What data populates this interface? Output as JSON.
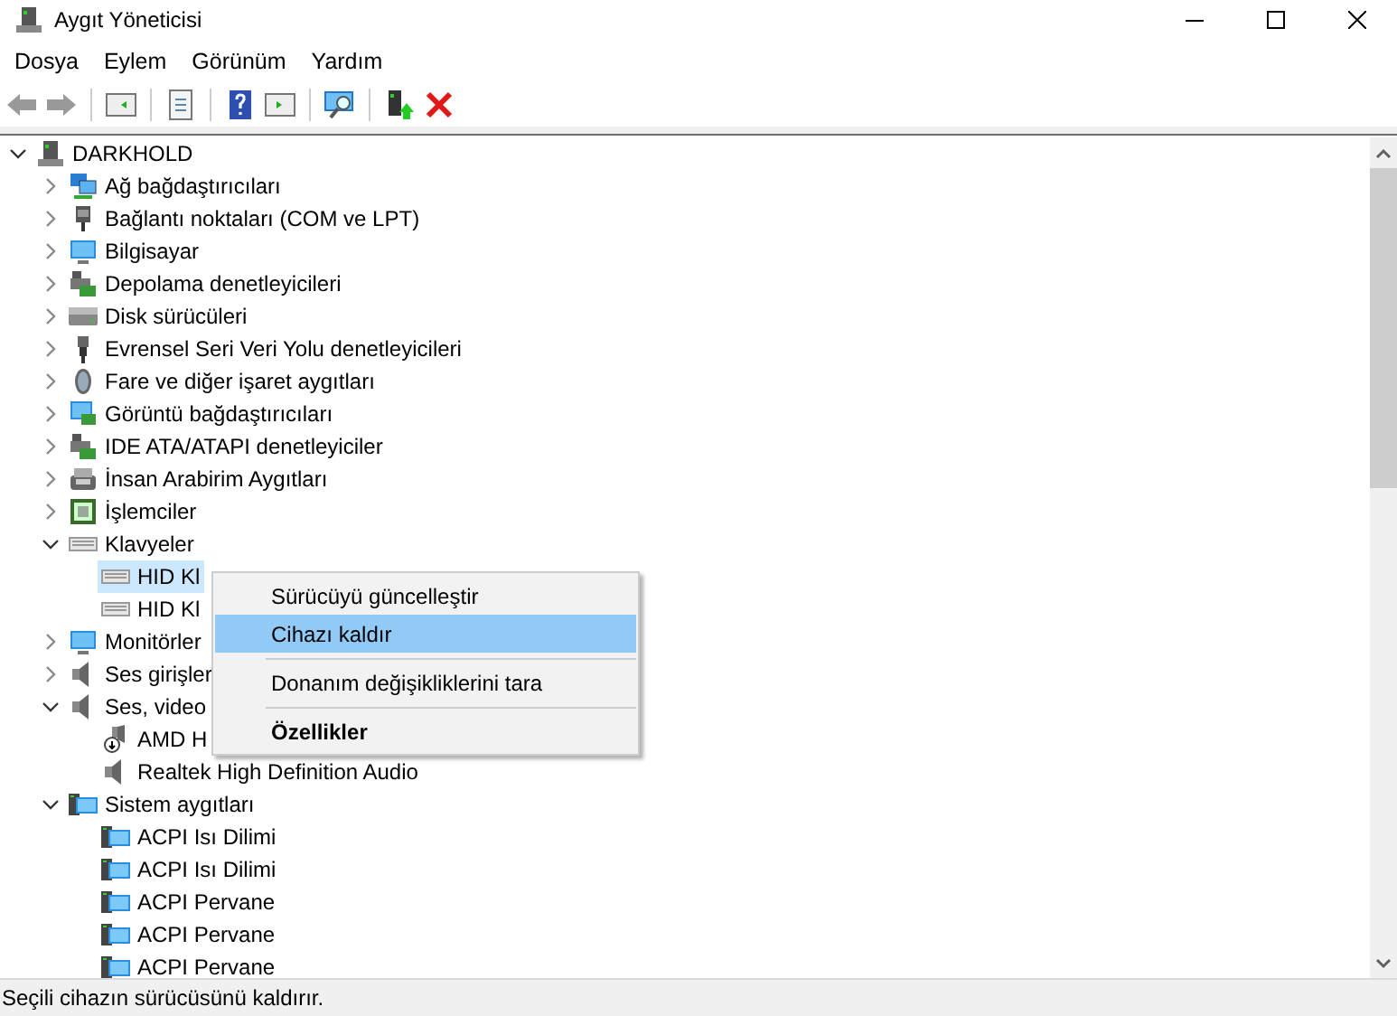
{
  "window": {
    "title": "Aygıt Yöneticisi"
  },
  "menu": [
    {
      "label": "Dosya"
    },
    {
      "label": "Eylem"
    },
    {
      "label": "Görünüm"
    },
    {
      "label": "Yardım"
    }
  ],
  "tree": {
    "label": "DARKHOLD",
    "kind": "computer",
    "expanded": true,
    "selected": false,
    "children": [
      {
        "label": "Ağ bağdaştırıcıları",
        "kind": "network",
        "expanded": false,
        "selected": false
      },
      {
        "label": "Bağlantı noktaları (COM ve LPT)",
        "kind": "port",
        "expanded": false,
        "selected": false
      },
      {
        "label": "Bilgisayar",
        "kind": "monitor",
        "expanded": false,
        "selected": false
      },
      {
        "label": "Depolama denetleyicileri",
        "kind": "storage",
        "expanded": false,
        "selected": false
      },
      {
        "label": "Disk sürücüleri",
        "kind": "disk",
        "expanded": false,
        "selected": false
      },
      {
        "label": "Evrensel Seri Veri Yolu denetleyicileri",
        "kind": "usb",
        "expanded": false,
        "selected": false
      },
      {
        "label": "Fare ve diğer işaret aygıtları",
        "kind": "mouse",
        "expanded": false,
        "selected": false
      },
      {
        "label": "Görüntü bağdaştırıcıları",
        "kind": "display",
        "expanded": false,
        "selected": false
      },
      {
        "label": "IDE ATA/ATAPI denetleyiciler",
        "kind": "storage",
        "expanded": false,
        "selected": false
      },
      {
        "label": "İnsan Arabirim Aygıtları",
        "kind": "hid",
        "expanded": false,
        "selected": false
      },
      {
        "label": "İşlemciler",
        "kind": "cpu",
        "expanded": false,
        "selected": false
      },
      {
        "label": "Klavyeler",
        "kind": "keyboard",
        "expanded": true,
        "selected": false,
        "children": [
          {
            "label": "HID Kl",
            "kind": "keyboard",
            "selected": true
          },
          {
            "label": "HID Kl",
            "kind": "keyboard",
            "selected": false
          }
        ]
      },
      {
        "label": "Monitörler",
        "kind": "monitor",
        "expanded": false,
        "selected": false
      },
      {
        "label": "Ses girişler",
        "kind": "speaker",
        "expanded": false,
        "selected": false
      },
      {
        "label": "Ses, video",
        "kind": "speaker",
        "expanded": true,
        "selected": false,
        "children": [
          {
            "label": "AMD H",
            "kind": "audio",
            "selected": false
          },
          {
            "label": "Realtek High Definition Audio",
            "kind": "speaker",
            "selected": false
          }
        ]
      },
      {
        "label": "Sistem aygıtları",
        "kind": "system",
        "expanded": true,
        "selected": false,
        "children": [
          {
            "label": "ACPI Isı Dilimi",
            "kind": "system",
            "selected": false
          },
          {
            "label": "ACPI Isı Dilimi",
            "kind": "system",
            "selected": false
          },
          {
            "label": "ACPI Pervane",
            "kind": "system",
            "selected": false
          },
          {
            "label": "ACPI Pervane",
            "kind": "system",
            "selected": false
          },
          {
            "label": "ACPI Pervane",
            "kind": "system",
            "selected": false
          }
        ]
      }
    ]
  },
  "context_menu": [
    {
      "kind": "item",
      "label": "Sürücüyü güncelleştir",
      "selected": false
    },
    {
      "kind": "item",
      "label": "Cihazı kaldır",
      "selected": true
    },
    {
      "kind": "separator"
    },
    {
      "kind": "item",
      "label": "Donanım değişikliklerini tara",
      "selected": false
    },
    {
      "kind": "separator"
    },
    {
      "kind": "default",
      "label": "Özellikler",
      "selected": false
    }
  ],
  "status_bar": "Seçili cihazın sürücüsünü kaldırır."
}
